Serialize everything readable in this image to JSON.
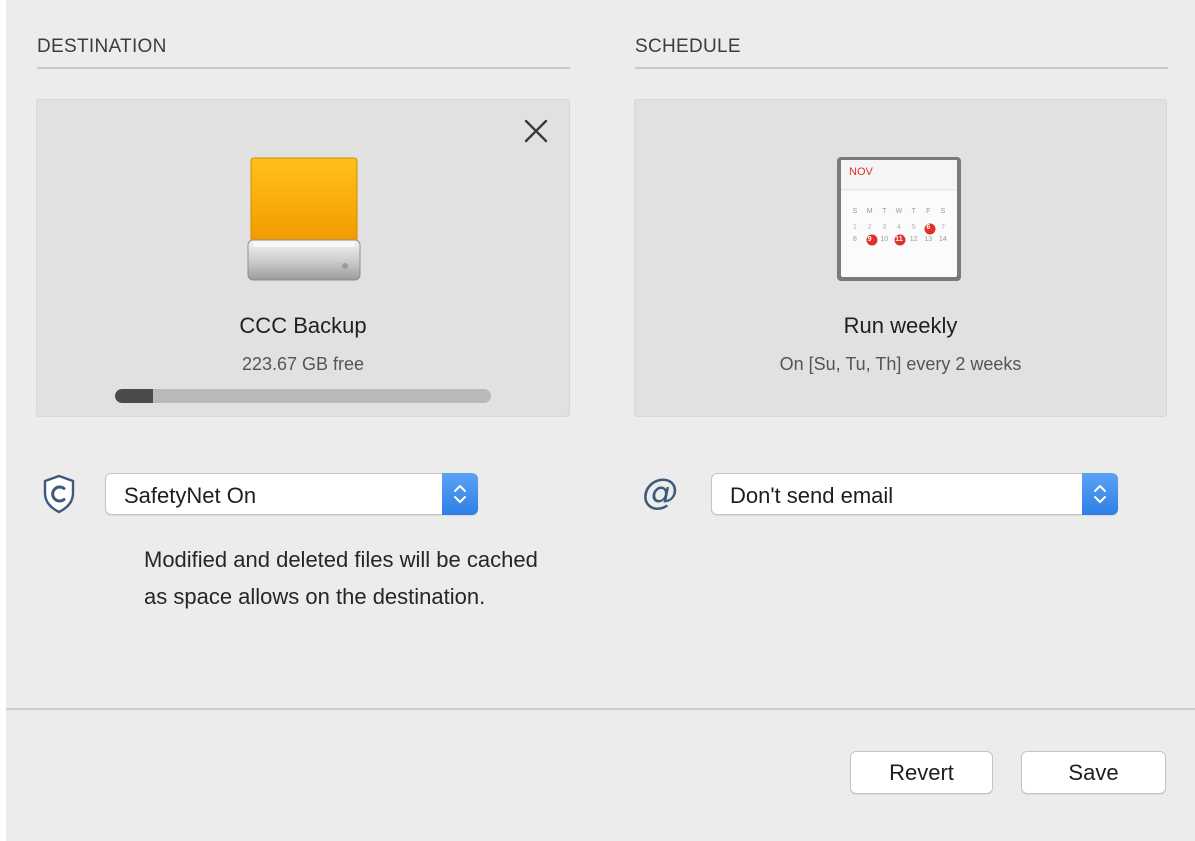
{
  "destination": {
    "section_title": "DESTINATION",
    "drive_name": "CCC Backup",
    "free_space": "223.67 GB free",
    "used_fraction": 0.1,
    "drive_color": "#f6a800",
    "safetynet": {
      "selected": "SafetyNet On",
      "description": "Modified and deleted files will be cached as space allows on the destination."
    }
  },
  "schedule": {
    "section_title": "SCHEDULE",
    "calendar_month": "NOV",
    "calendar_weekdays": [
      "S",
      "M",
      "T",
      "W",
      "T",
      "F",
      "S"
    ],
    "calendar_row1": [
      "1",
      "2",
      "3",
      "4",
      "5",
      "6",
      "7"
    ],
    "calendar_row2": [
      "8",
      "9",
      "10",
      "11",
      "12",
      "13",
      "14"
    ],
    "title": "Run weekly",
    "subtitle": "On [Su, Tu, Th] every 2 weeks",
    "email": {
      "selected": "Don't send email"
    }
  },
  "footer": {
    "revert_label": "Revert",
    "save_label": "Save"
  },
  "colors": {
    "accent_blue": "#2f7fe8",
    "calendar_red": "#e0302a",
    "shield_blue": "#3d5a7a"
  }
}
